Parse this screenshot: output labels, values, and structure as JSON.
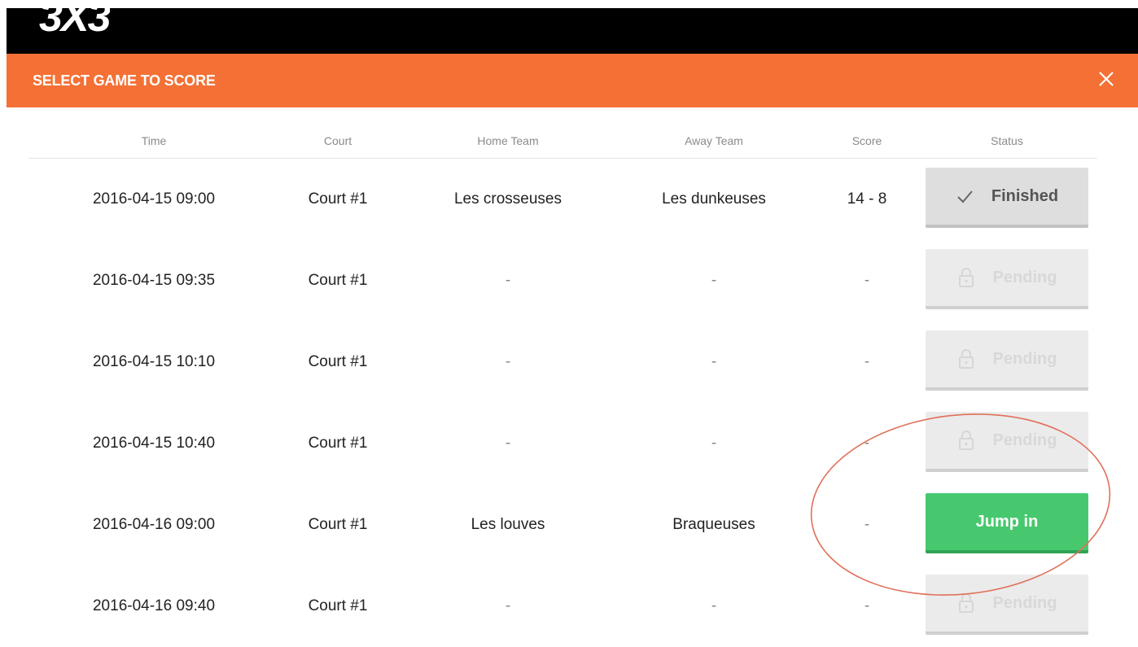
{
  "logo": {
    "text": "3X3"
  },
  "header": {
    "title": "SELECT GAME TO SCORE",
    "close_icon": "close-icon"
  },
  "table": {
    "columns": [
      "Time",
      "Court",
      "Home Team",
      "Away Team",
      "Score",
      "Status"
    ],
    "rows": [
      {
        "time": "2016-04-15 09:00",
        "court": "Court #1",
        "home": "Les crosseuses",
        "away": "Les dunkeuses",
        "score": "14 - 8",
        "status": "Finished",
        "status_icon": "check-icon"
      },
      {
        "time": "2016-04-15 09:35",
        "court": "Court #1",
        "home": "-",
        "away": "-",
        "score": "-",
        "status": "Pending",
        "status_icon": "lock-icon"
      },
      {
        "time": "2016-04-15 10:10",
        "court": "Court #1",
        "home": "-",
        "away": "-",
        "score": "-",
        "status": "Pending",
        "status_icon": "lock-icon"
      },
      {
        "time": "2016-04-15 10:40",
        "court": "Court #1",
        "home": "-",
        "away": "-",
        "score": "-",
        "status": "Pending",
        "status_icon": "lock-icon"
      },
      {
        "time": "2016-04-16 09:00",
        "court": "Court #1",
        "home": "Les louves",
        "away": "Braqueuses",
        "score": "-",
        "status": "Jump in",
        "status_icon": ""
      },
      {
        "time": "2016-04-16 09:40",
        "court": "Court #1",
        "home": "-",
        "away": "-",
        "score": "-",
        "status": "Pending",
        "status_icon": "lock-icon"
      }
    ]
  },
  "colors": {
    "header_bg": "#f47035",
    "jump_in": "#47c86e",
    "annotation": "#e0705a"
  }
}
